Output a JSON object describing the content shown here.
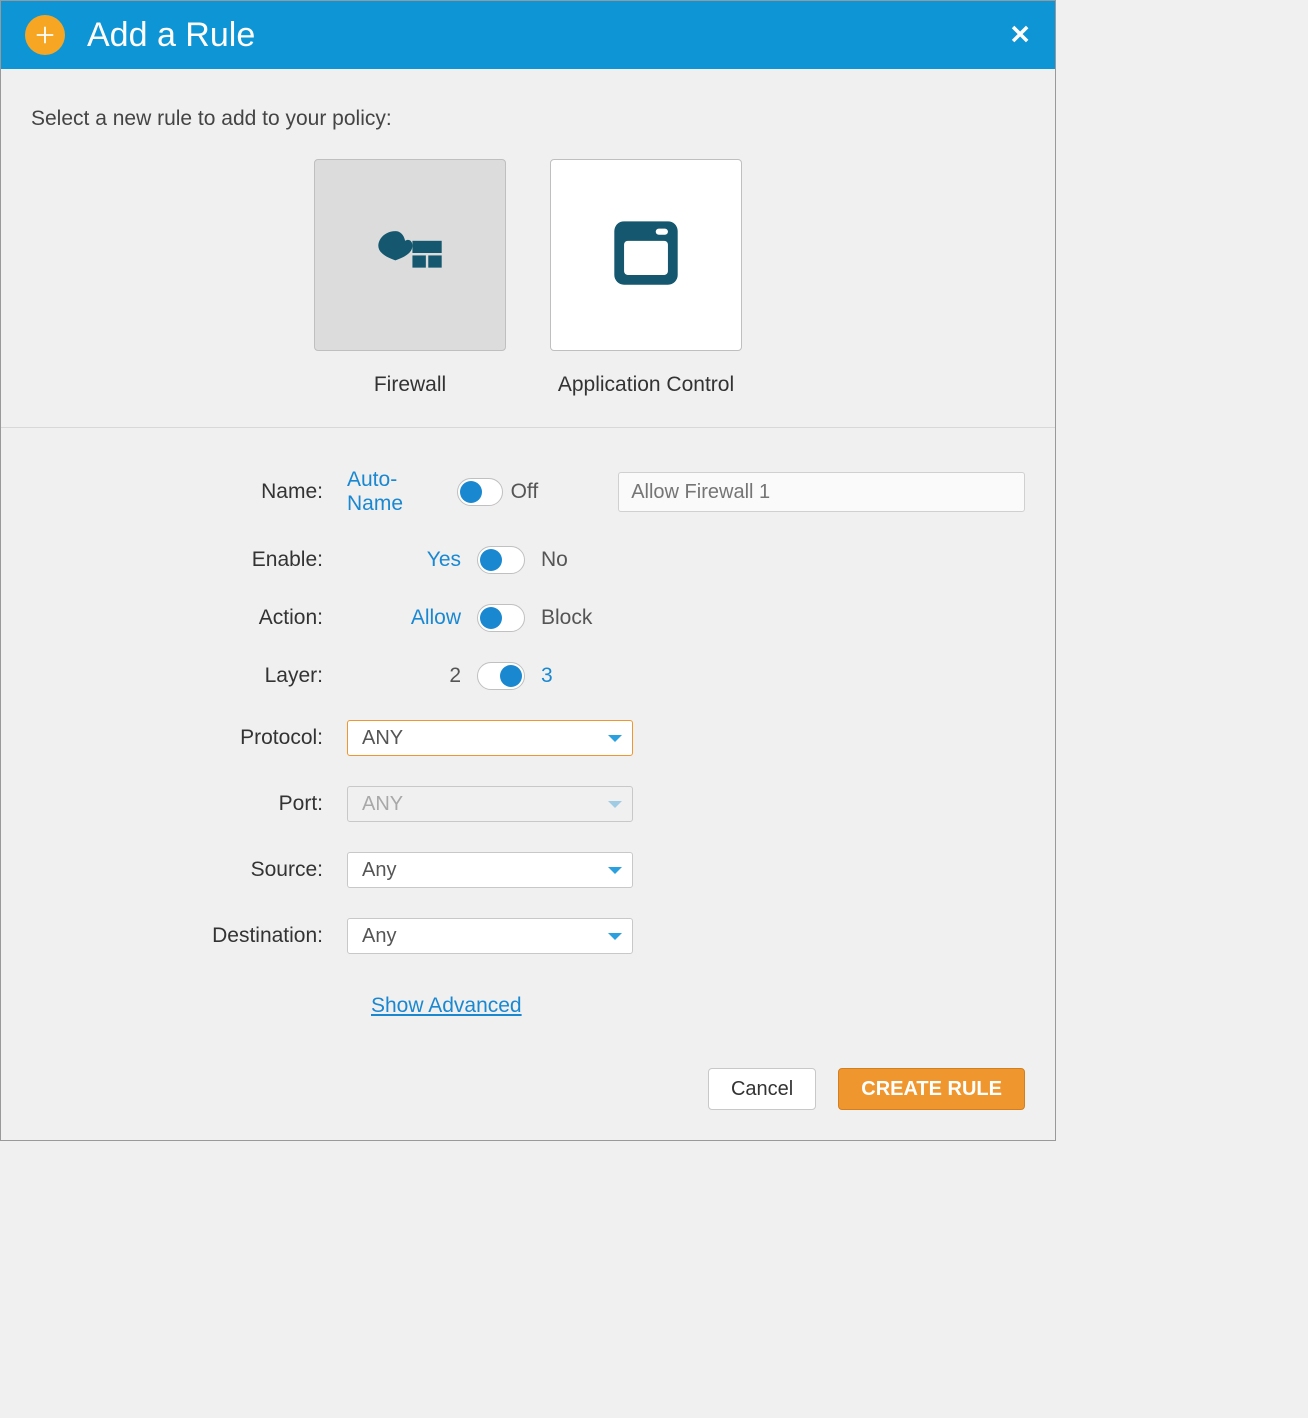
{
  "title": "Add a Rule",
  "prompt": "Select a new rule to add to your policy:",
  "tiles": {
    "firewall": "Firewall",
    "appcontrol": "Application Control"
  },
  "form": {
    "name": {
      "label": "Name:",
      "left": "Auto-Name",
      "right": "Off",
      "input_placeholder": "Allow Firewall 1"
    },
    "enable": {
      "label": "Enable:",
      "left": "Yes",
      "right": "No"
    },
    "action": {
      "label": "Action:",
      "left": "Allow",
      "right": "Block"
    },
    "layer": {
      "label": "Layer:",
      "left": "2",
      "right": "3"
    },
    "protocol": {
      "label": "Protocol:",
      "value": "ANY"
    },
    "port": {
      "label": "Port:",
      "value": "ANY"
    },
    "source": {
      "label": "Source:",
      "value": "Any"
    },
    "destination": {
      "label": "Destination:",
      "value": "Any"
    },
    "show_advanced": "Show Advanced"
  },
  "buttons": {
    "cancel": "Cancel",
    "create": "CREATE RULE"
  }
}
